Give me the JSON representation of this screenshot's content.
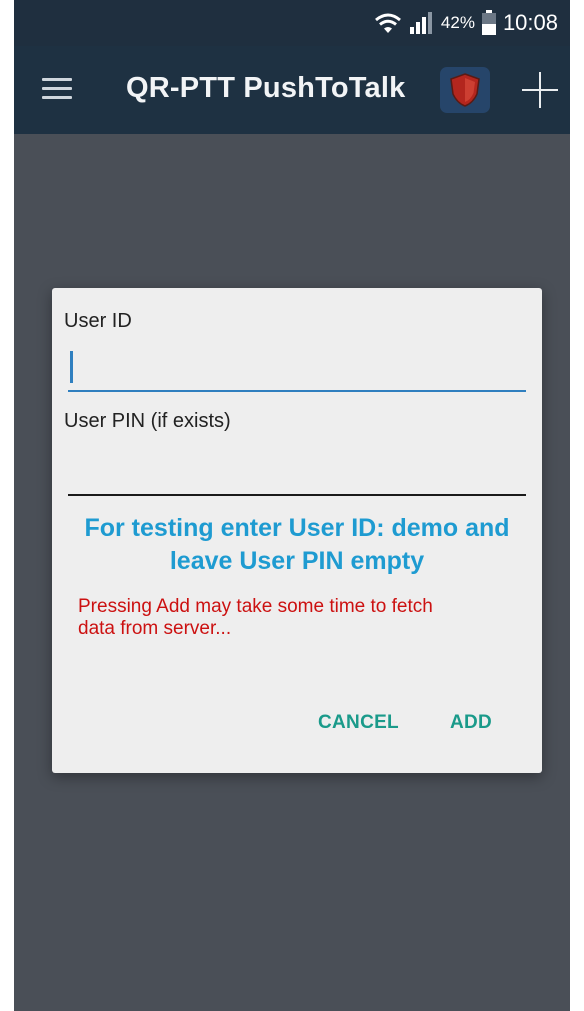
{
  "status_bar": {
    "battery_percent": "42%",
    "time": "10:08"
  },
  "app_bar": {
    "title": "QR-PTT PushToTalk"
  },
  "dialog": {
    "user_id_label": "User ID",
    "user_id_value": "",
    "user_pin_label": "User PIN (if exists)",
    "user_pin_value": "",
    "info_line1": "For testing enter User ID: demo and",
    "info_line2": "leave User PIN empty",
    "warning_line1": "Pressing Add may take some time to fetch",
    "warning_line2": "data from server...",
    "cancel_label": "CANCEL",
    "add_label": "ADD"
  },
  "colors": {
    "accent_blue": "#1e9bd1",
    "warning_red": "#cc1111",
    "button_teal": "#1a9a8a",
    "app_bar": "#1e3142",
    "overlay": "#4a4f57"
  },
  "icons": [
    "wifi-icon",
    "signal-icon",
    "battery-icon",
    "menu-icon",
    "app-logo-icon",
    "plus-icon"
  ]
}
